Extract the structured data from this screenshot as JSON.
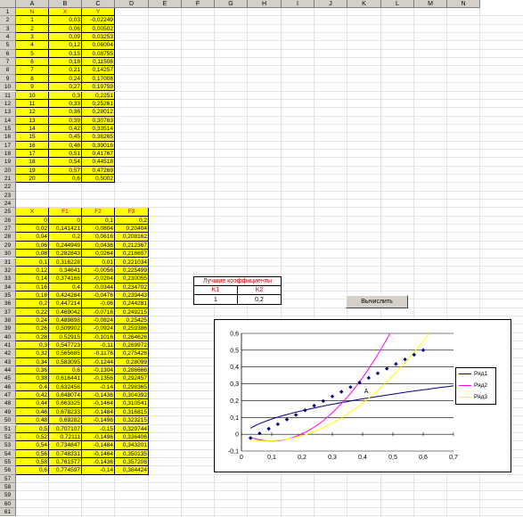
{
  "columns": [
    "A",
    "B",
    "C",
    "D",
    "E",
    "F",
    "G",
    "H",
    "I",
    "J",
    "K",
    "L",
    "M",
    "N"
  ],
  "table1": {
    "headers": [
      "N",
      "X",
      "Y"
    ],
    "rows": [
      [
        "1",
        "0,03",
        "-0,02249"
      ],
      [
        "2",
        "0,06",
        "0,00502"
      ],
      [
        "3",
        "0,09",
        "0,03253"
      ],
      [
        "4",
        "0,12",
        "0,06004"
      ],
      [
        "5",
        "0,15",
        "0,08755"
      ],
      [
        "6",
        "0,18",
        "0,11506"
      ],
      [
        "7",
        "0,21",
        "0,14257"
      ],
      [
        "8",
        "0,24",
        "0,17008"
      ],
      [
        "9",
        "0,27",
        "0,19759"
      ],
      [
        "10",
        "0,3",
        "0,2251"
      ],
      [
        "11",
        "0,33",
        "0,25261"
      ],
      [
        "12",
        "0,36",
        "0,28012"
      ],
      [
        "13",
        "0,39",
        "0,30763"
      ],
      [
        "14",
        "0,42",
        "0,33514"
      ],
      [
        "15",
        "0,45",
        "0,36265"
      ],
      [
        "16",
        "0,48",
        "0,39016"
      ],
      [
        "17",
        "0,51",
        "0,41767"
      ],
      [
        "18",
        "0,54",
        "0,44518"
      ],
      [
        "19",
        "0,57",
        "0,47269"
      ],
      [
        "20",
        "0,6",
        "0,5002"
      ]
    ]
  },
  "table2": {
    "headers": [
      "X",
      "F1",
      "F2",
      "F3"
    ],
    "rows": [
      [
        "0",
        "0",
        "0,1",
        "0,2"
      ],
      [
        "0,02",
        "0,141421",
        "0,0804",
        "0,20404"
      ],
      [
        "0,04",
        "0,2",
        "0,0616",
        "0,208162"
      ],
      [
        "0,06",
        "0,244949",
        "0,0436",
        "0,212367"
      ],
      [
        "0,08",
        "0,282843",
        "0,0264",
        "0,216657"
      ],
      [
        "0,1",
        "0,316228",
        "0,01",
        "0,221034"
      ],
      [
        "0,12",
        "0,34641",
        "-0,0056",
        "0,225499"
      ],
      [
        "0,14",
        "0,374166",
        "-0,0204",
        "0,230055"
      ],
      [
        "0,16",
        "0,4",
        "-0,0344",
        "0,234702"
      ],
      [
        "0,18",
        "0,424264",
        "-0,0476",
        "0,239443"
      ],
      [
        "0,2",
        "0,447214",
        "-0,06",
        "0,244281"
      ],
      [
        "0,22",
        "0,469042",
        "-0,0716",
        "0,249215"
      ],
      [
        "0,24",
        "0,489898",
        "-0,0824",
        "0,25425"
      ],
      [
        "0,26",
        "0,509902",
        "-0,0924",
        "0,259386"
      ],
      [
        "0,28",
        "0,52915",
        "-0,1016",
        "0,264626"
      ],
      [
        "0,3",
        "0,547723",
        "-0,11",
        "0,269972"
      ],
      [
        "0,32",
        "0,565685",
        "-0,1176",
        "0,275426"
      ],
      [
        "0,34",
        "0,583095",
        "-0,1244",
        "0,28099"
      ],
      [
        "0,36",
        "0,6",
        "-0,1304",
        "0,286666"
      ],
      [
        "0,38",
        "0,616441",
        "-0,1356",
        "0,292457"
      ],
      [
        "0,4",
        "0,632456",
        "-0,14",
        "0,298365"
      ],
      [
        "0,42",
        "0,648074",
        "-0,1436",
        "0,304392"
      ],
      [
        "0,44",
        "0,663325",
        "-0,1464",
        "0,310541"
      ],
      [
        "0,46",
        "0,678233",
        "-0,1484",
        "0,316815"
      ],
      [
        "0,48",
        "0,69282",
        "-0,1496",
        "0,323215"
      ],
      [
        "0,5",
        "0,707107",
        "-0,15",
        "0,329744"
      ],
      [
        "0,52",
        "0,72111",
        "-0,1496",
        "0,336406"
      ],
      [
        "0,54",
        "0,734847",
        "-0,1484",
        "0,343201"
      ],
      [
        "0,56",
        "0,748331",
        "-0,1464",
        "0,350135"
      ],
      [
        "0,58",
        "0,761577",
        "-0,1436",
        "0,357208"
      ],
      [
        "0,6",
        "0,774597",
        "-0,14",
        "0,364424"
      ]
    ]
  },
  "coefficients": {
    "title": "Лучшие коэффициенты",
    "k1_label": "K1",
    "k2_label": "K2",
    "k1_value": "1",
    "k2_value": "0,2"
  },
  "button_label": "Вычислить",
  "chart_data": {
    "type": "line",
    "xlim": [
      0,
      0.7
    ],
    "ylim": [
      -0.1,
      0.6
    ],
    "x_ticks": [
      "0",
      "0,1",
      "0,2",
      "0,3",
      "0,4",
      "0,5",
      "0,6",
      "0,7"
    ],
    "y_ticks": [
      "-0,1",
      "0",
      "0,1",
      "0,2",
      "0,3",
      "0,4",
      "0,5",
      "0,6"
    ],
    "grid": true,
    "legend_position": "right",
    "annotation": "A",
    "points": {
      "x": [
        0.03,
        0.06,
        0.09,
        0.12,
        0.15,
        0.18,
        0.21,
        0.24,
        0.27,
        0.3,
        0.33,
        0.36,
        0.39,
        0.42,
        0.45,
        0.48,
        0.51,
        0.54,
        0.57,
        0.6
      ],
      "y": [
        -0.02249,
        0.00502,
        0.03253,
        0.06004,
        0.08755,
        0.11506,
        0.14257,
        0.17008,
        0.19759,
        0.2251,
        0.25261,
        0.28012,
        0.30763,
        0.33514,
        0.36265,
        0.39016,
        0.41767,
        0.44518,
        0.47269,
        0.5002
      ]
    },
    "series": [
      {
        "name": "Ряд1",
        "color": "#000080"
      },
      {
        "name": "Ряд2",
        "color": "#ff00ff"
      },
      {
        "name": "Ряд3",
        "color": "#ffff00"
      }
    ]
  }
}
